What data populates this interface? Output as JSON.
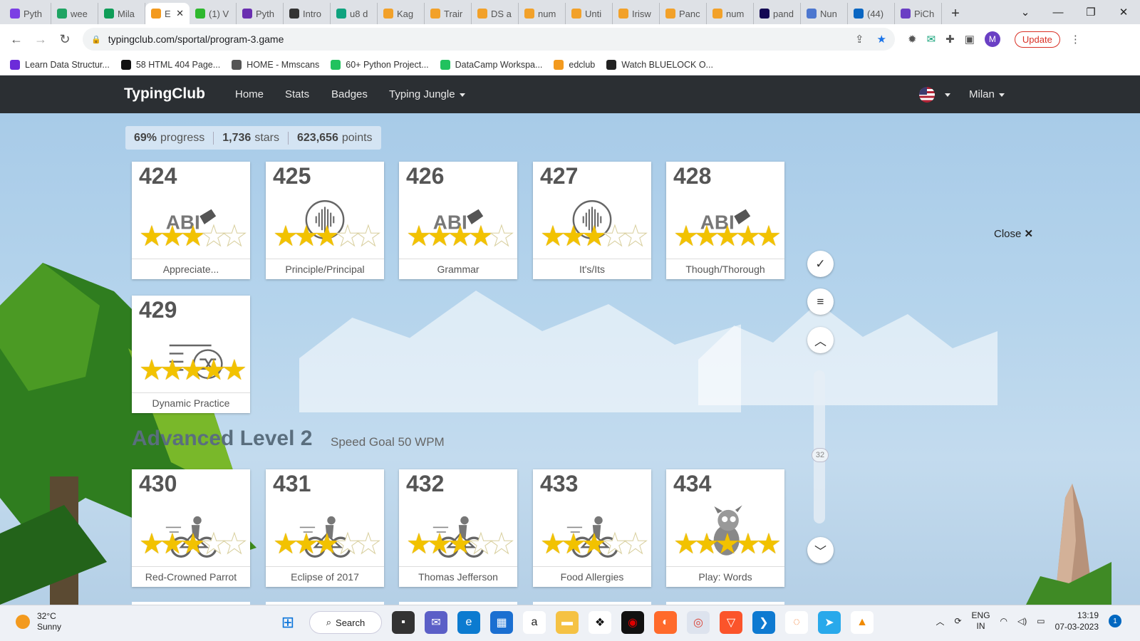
{
  "browser": {
    "tabs": [
      {
        "label": "Pyth",
        "color": "#7b3fe4"
      },
      {
        "label": "wee",
        "color": "#1fa463"
      },
      {
        "label": "Mila",
        "color": "#0f9d58"
      },
      {
        "label": "E",
        "color": "#f39a1e",
        "active": true
      },
      {
        "label": "(1) V",
        "color": "#2eb82e"
      },
      {
        "label": "Pyth",
        "color": "#6a2fb0"
      },
      {
        "label": "Intro",
        "color": "#333333"
      },
      {
        "label": "u8 d",
        "color": "#10a37f"
      },
      {
        "label": "Kag",
        "color": "#f2a12a"
      },
      {
        "label": "Trair",
        "color": "#f2a12a"
      },
      {
        "label": "DS a",
        "color": "#f2a12a"
      },
      {
        "label": "num",
        "color": "#f2a12a"
      },
      {
        "label": "Unti",
        "color": "#f2a12a"
      },
      {
        "label": "Irisw",
        "color": "#f2a12a"
      },
      {
        "label": "Panc",
        "color": "#f2a12a"
      },
      {
        "label": "num",
        "color": "#f2a12a"
      },
      {
        "label": "pand",
        "color": "#130754"
      },
      {
        "label": "Nun",
        "color": "#4d77cf"
      },
      {
        "label": "(44)",
        "color": "#0a66c2"
      },
      {
        "label": "PiCh",
        "color": "#6a3fc4"
      }
    ],
    "tab_close": "✕",
    "new_tab": "+",
    "url": "typingclub.com/sportal/program-3.game",
    "profile_initial": "M",
    "update_label": "Update",
    "bookmarks": [
      {
        "label": "Learn Data Structur...",
        "color": "#6c2bd9"
      },
      {
        "label": "58 HTML 404 Page...",
        "color": "#111111"
      },
      {
        "label": "HOME - Mmscans",
        "color": "#555555"
      },
      {
        "label": "60+ Python Project...",
        "color": "#21c25e"
      },
      {
        "label": "DataCamp Workspa...",
        "color": "#21c25e"
      },
      {
        "label": "edclub",
        "color": "#f39a1e"
      },
      {
        "label": "Watch BLUELOCK O...",
        "color": "#222222"
      }
    ]
  },
  "site": {
    "logo": "TypingClub",
    "nav": {
      "home": "Home",
      "stats": "Stats",
      "badges": "Badges",
      "jungle": "Typing Jungle"
    },
    "user": "Milan",
    "progress": {
      "pct": "69%",
      "pct_label": "progress",
      "stars": "1,736",
      "stars_label": "stars",
      "points": "623,656",
      "points_label": "points"
    },
    "close_label": "Close",
    "scroll_value": "32",
    "level": {
      "title": "Advanced Level 2",
      "goal": "Speed Goal 50 WPM"
    },
    "lessons": [
      {
        "num": "424",
        "label": "Appreciate...",
        "icon": "abc-eraser-icon",
        "stars": 3
      },
      {
        "num": "425",
        "label": "Principle/Principal",
        "icon": "audio-wave-icon",
        "stars": 3
      },
      {
        "num": "426",
        "label": "Grammar",
        "icon": "abc-eraser-icon",
        "stars": 4
      },
      {
        "num": "427",
        "label": "It's/Its",
        "icon": "audio-wave-icon",
        "stars": 3
      },
      {
        "num": "428",
        "label": "Though/Thorough",
        "icon": "abc-eraser-icon",
        "stars": 5
      },
      {
        "num": "429",
        "label": "Dynamic Practice",
        "icon": "shuffle-icon",
        "stars": 5
      },
      {
        "num": "430",
        "label": "Red-Crowned Parrot",
        "icon": "cyclist-icon",
        "stars": 3
      },
      {
        "num": "431",
        "label": "Eclipse of 2017",
        "icon": "cyclist-icon",
        "stars": 3
      },
      {
        "num": "432",
        "label": "Thomas Jefferson",
        "icon": "cyclist-icon",
        "stars": 3
      },
      {
        "num": "433",
        "label": "Food Allergies",
        "icon": "cyclist-icon",
        "stars": 3
      },
      {
        "num": "434",
        "label": "Play: Words",
        "icon": "game-creature-icon",
        "stars": 5
      }
    ]
  },
  "taskbar": {
    "temp": "32°C",
    "condition": "Sunny",
    "search_label": "Search",
    "lang": "ENG",
    "region": "IN",
    "time": "13:19",
    "date": "07-03-2023",
    "notifications": "1"
  }
}
